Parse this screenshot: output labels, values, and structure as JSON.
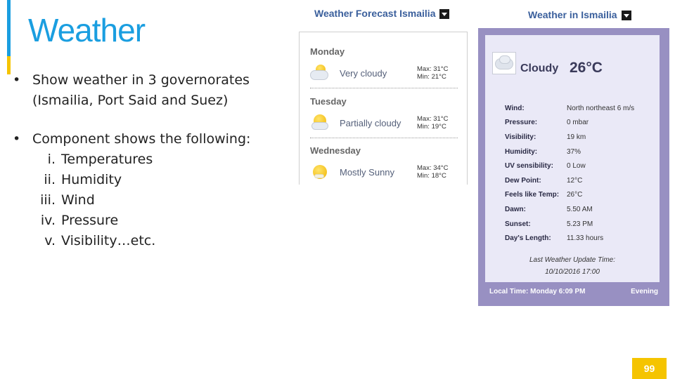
{
  "slide": {
    "title": "Weather",
    "page_number": "99"
  },
  "bullets": [
    {
      "text": "Show weather in 3 governorates (Ismailia, Port Said and Suez)"
    },
    {
      "text": "Component shows the following:"
    }
  ],
  "components": [
    {
      "num": "i.",
      "label": "Temperatures"
    },
    {
      "num": "ii.",
      "label": "Humidity"
    },
    {
      "num": "iii.",
      "label": "Wind"
    },
    {
      "num": "iv.",
      "label": "Pressure"
    },
    {
      "num": "v.",
      "label": "Visibility…etc."
    }
  ],
  "forecast": {
    "title": "Weather Forecast Ismailia",
    "days": [
      {
        "day": "Monday",
        "condition": "Very cloudy",
        "max": "Max: 31°C",
        "min": "Min: 21°C",
        "icon": "cloudy-icon"
      },
      {
        "day": "Tuesday",
        "condition": "Partially cloudy",
        "max": "Max: 31°C",
        "min": "Min: 19°C",
        "icon": "partly-cloudy-icon"
      },
      {
        "day": "Wednesday",
        "condition": "Mostly Sunny",
        "max": "Max: 34°C",
        "min": "Min: 18°C",
        "icon": "sunny-icon"
      }
    ]
  },
  "current": {
    "title": "Weather in Ismailia",
    "condition": "Cloudy",
    "temperature": "26°C",
    "icon": "cloud-icon",
    "rows": [
      {
        "label": "Wind:",
        "value": "North northeast 6 m/s"
      },
      {
        "label": "Pressure:",
        "value": "0 mbar"
      },
      {
        "label": "Visibility:",
        "value": "19 km"
      },
      {
        "label": "Humidity:",
        "value": "37%"
      },
      {
        "label": "UV sensibility:",
        "value": "0 Low"
      },
      {
        "label": "Dew Point:",
        "value": "12°C"
      },
      {
        "label": "Feels like Temp:",
        "value": "26°C"
      },
      {
        "label": "Dawn:",
        "value": "5.50 AM"
      },
      {
        "label": "Sunset:",
        "value": "5.23 PM"
      },
      {
        "label": "Day's Length:",
        "value": "11.33 hours"
      }
    ],
    "update_label": "Last Weather Update Time:",
    "update_time": "10/10/2016 17:00",
    "local_time": "Local Time: Monday 6:09 PM",
    "period": "Evening"
  },
  "colors": {
    "title_blue": "#1a9ee0",
    "accent_yellow": "#f5c400",
    "widget_title": "#3a5f9c",
    "panel_purple": "#9890c2",
    "panel_inner": "#eae9f7"
  }
}
